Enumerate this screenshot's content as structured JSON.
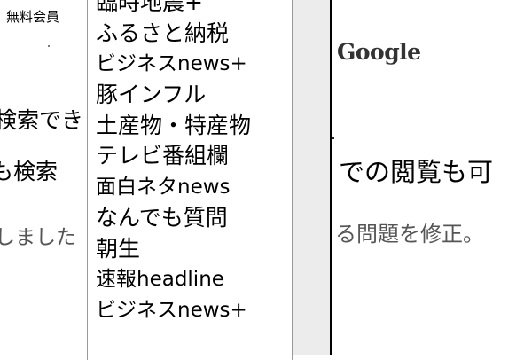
{
  "background": {
    "top_left_text": "、無料会員",
    "lines": [
      "検索でき",
      "も検索",
      "しました"
    ],
    "right_logo": "Google",
    "right_lines": [
      "での閲覧も可",
      "る問題を修正。"
    ]
  },
  "dropdown": {
    "items": [
      "臨時地震+",
      "ふるさと納税",
      "ビジネスnews+",
      "豚インフル",
      "土産物・特産物",
      "テレビ番組欄",
      "面白ネタnews",
      "なんでも質問",
      "朝生",
      "速報headline",
      "ビジネスnews+"
    ]
  },
  "colors": {
    "text": "#000000",
    "muted_text": "#555555",
    "gutter": "#ececec",
    "border": "#9a9a9a"
  }
}
